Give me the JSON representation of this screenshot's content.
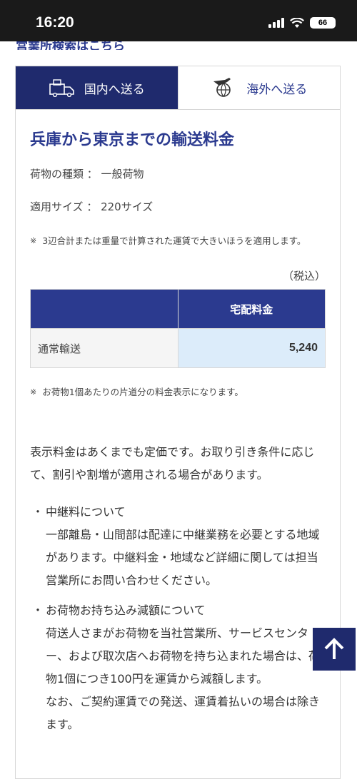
{
  "status": {
    "time": "16:20",
    "battery": "66"
  },
  "top_link": {
    "text": "営業所検索はこちら"
  },
  "tabs": [
    {
      "label": "国内へ送る",
      "icon": "truck-box-icon",
      "active": true
    },
    {
      "label": "海外へ送る",
      "icon": "plane-globe-icon",
      "active": false
    }
  ],
  "result": {
    "heading": "兵庫から東京までの輸送料金",
    "cargo_type_line": "荷物の種類 ： 一般荷物",
    "size_line": "適用サイズ ： 220サイズ",
    "note1_mark": "※",
    "note1": "3辺合計または重量で計算された運賃で大きいほうを適用します。",
    "tax_label": "（税込）",
    "table": {
      "header_col2": "宅配料金",
      "row_label": "通常輸送",
      "row_value": "5,240"
    },
    "note2_mark": "※",
    "note2": "お荷物1個あたりの片道分の料金表示になります。"
  },
  "info": {
    "paragraph": "表示料金はあくまでも定価です。お取り引き条件に応じて、割引や割増が適用される場合があります。",
    "bullet_mark": "・",
    "bullet1_title": "中継料について",
    "bullet1_body": "一部離島・山間部は配達に中継業務を必要とする地域があります。中継料金・地域など詳細に関しては担当営業所にお問い合わせください。",
    "bullet2_title": "お荷物お持ち込み減額について",
    "bullet2_body": "荷送人さまがお荷物を当社営業所、サービスセンター、および取次店へお荷物を持ち込まれた場合は、荷物1個につき100円を運賃から減額します。",
    "bullet2_extra": "なお、ご契約運賃での発送、運賃着払いの場合は除きます。"
  },
  "colors": {
    "navy": "#1f2a6d",
    "link_blue": "#2b3a8f",
    "value_bg": "#dcecfa"
  }
}
